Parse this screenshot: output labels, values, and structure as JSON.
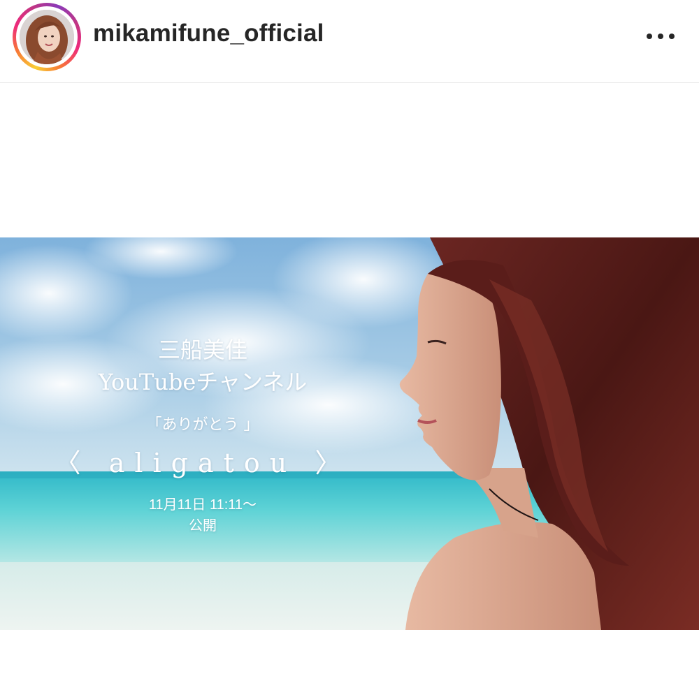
{
  "post": {
    "username": "mikamifune_official",
    "more_icon": "more-horizontal-icon",
    "image": {
      "description_type": "photo",
      "overlay": {
        "name": "三船美佳",
        "channel": "YouTubeチャンネル",
        "quote": "「ありがとう 」",
        "title": "〈 aligatou 〉",
        "date": "11月11日 11:11〜",
        "release": "公開"
      }
    }
  },
  "colors": {
    "username": "#262626",
    "sky": "#8fbfe0",
    "sea": "#4fc7d2",
    "hair": "#5a1f1c"
  }
}
